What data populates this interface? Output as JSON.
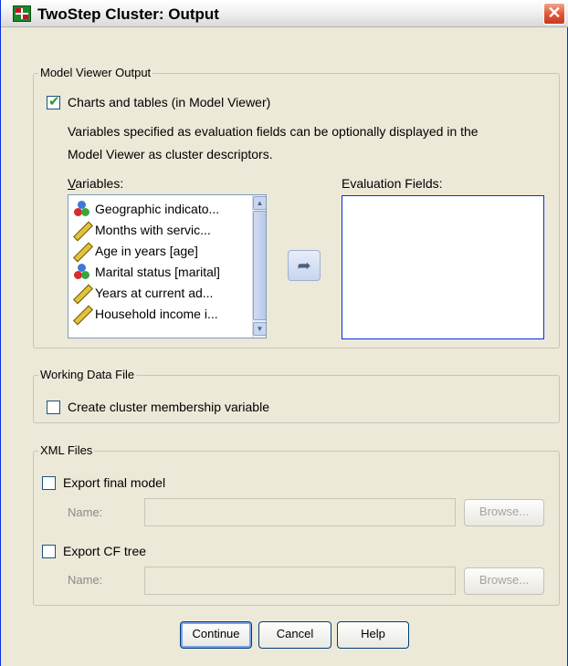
{
  "window": {
    "title": "TwoStep Cluster: Output",
    "close_glyph": "✕"
  },
  "model_viewer": {
    "legend": "Model Viewer Output",
    "charts_checkbox_label": "Charts and tables (in Model Viewer)",
    "charts_checked": true,
    "description_line1": "Variables specified as evaluation fields can be optionally displayed in the",
    "description_line2": "Model Viewer as cluster descriptors.",
    "variables_label": "Variables:",
    "evaluation_label": "Evaluation Fields:",
    "variables": [
      {
        "label": "Geographic indicato...",
        "icon": "nominal-icon"
      },
      {
        "label": "Months with servic...",
        "icon": "scale-ruler-icon"
      },
      {
        "label": "Age in years [age]",
        "icon": "scale-ruler-icon"
      },
      {
        "label": "Marital status [marital]",
        "icon": "nominal-icon"
      },
      {
        "label": "Years at current ad...",
        "icon": "scale-ruler-icon"
      },
      {
        "label": "Household income i...",
        "icon": "scale-ruler-icon"
      }
    ],
    "evaluation_fields": [],
    "move_button_glyph": "➦"
  },
  "working_data": {
    "legend": "Working Data File",
    "membership_label": "Create cluster membership variable",
    "membership_checked": false
  },
  "xml_files": {
    "legend": "XML Files",
    "export_model_label": "Export final model",
    "export_model_checked": false,
    "export_model_name_label": "Name:",
    "export_model_name_value": "",
    "export_model_browse": "Browse...",
    "export_cf_label": "Export CF tree",
    "export_cf_checked": false,
    "export_cf_name_label": "Name:",
    "export_cf_name_value": "",
    "export_cf_browse": "Browse..."
  },
  "buttons": {
    "continue": "Continue",
    "cancel": "Cancel",
    "help": "Help"
  },
  "colors": {
    "window_bg": "#ece9d8",
    "accent_border": "#0831d9",
    "list_border": "#7f9db9"
  }
}
